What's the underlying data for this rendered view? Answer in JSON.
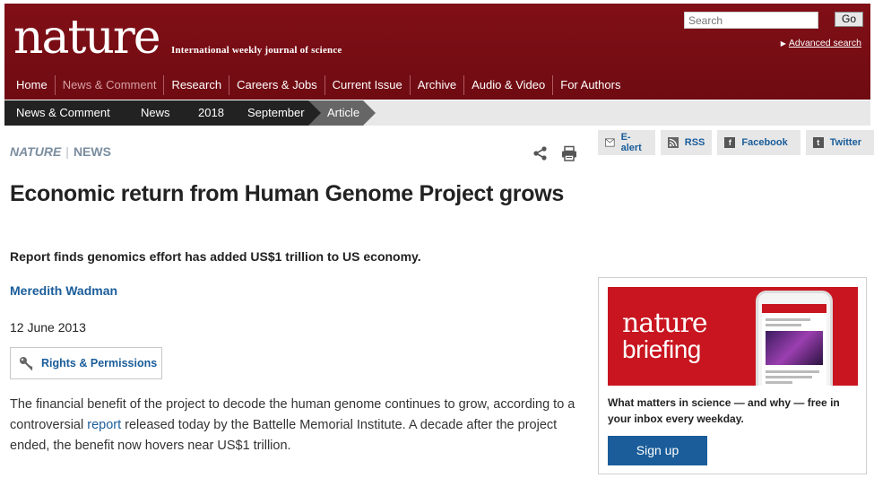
{
  "header": {
    "logo": "nature",
    "tagline": "International weekly journal of science",
    "search_placeholder": "Search",
    "go_label": "Go",
    "advanced_search": "Advanced search"
  },
  "nav": {
    "items": [
      "Home",
      "News & Comment",
      "Research",
      "Careers & Jobs",
      "Current Issue",
      "Archive",
      "Audio & Video",
      "For Authors"
    ],
    "active": "News & Comment"
  },
  "breadcrumb": [
    "News & Comment",
    "News",
    "2018",
    "September",
    "Article"
  ],
  "share": {
    "ealert": "E-alert",
    "rss": "RSS",
    "facebook": "Facebook",
    "twitter": "Twitter"
  },
  "article": {
    "journal": "NATURE",
    "section": "NEWS",
    "headline": "Economic return from Human Genome Project grows",
    "standfirst": "Report finds genomics effort has added US$1 trillion to US economy.",
    "author": "Meredith Wadman",
    "date": "12 June 2013",
    "rights": "Rights & Permissions",
    "body_before_link": "The financial benefit of the project to decode the human genome continues to grow, according to a controversial ",
    "body_link": "report",
    "body_after_link": " released today by the Battelle Memorial Institute. A decade after the project ended, the benefit now hovers near US$1 trillion."
  },
  "promo": {
    "title_line1": "nature",
    "title_line2": "briefing",
    "text": "What matters in science — and why — free in your inbox every weekday.",
    "button": "Sign up"
  },
  "colors": {
    "brand": "#7a0e15",
    "link": "#1a5d9a",
    "promo_red": "#c8151f"
  }
}
